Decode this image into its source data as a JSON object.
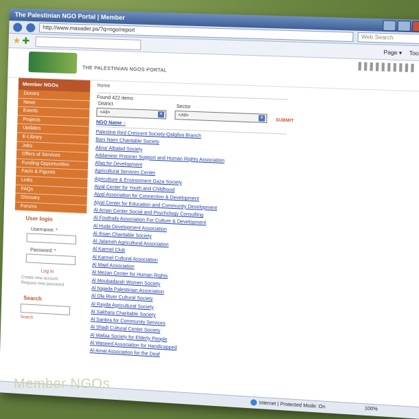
{
  "caption": "Member NGOs",
  "window": {
    "title": "The Palestinian NGO Portal | Member",
    "url": "http://www.masader.ps/?q=ngo/report",
    "search_placeholder": "Web Search"
  },
  "toolbar": {
    "page_label": "Page ▾",
    "tools_label": "Tools ▾"
  },
  "site": {
    "title": "THE PALESTINIAN NGOS PORTAL"
  },
  "sidebar": {
    "header": "Member NGOs",
    "items": [
      "Donors",
      "News",
      "Events",
      "Projects",
      "Updates",
      "E-Library",
      "Jobs",
      "Offers of Services",
      "Funding Opportunities",
      "Facts & Figures",
      "Links",
      "FAQs",
      "Glossary",
      "Forums"
    ]
  },
  "login": {
    "title": "User login",
    "username_label": "Username: *",
    "password_label": "Password: *",
    "button": "Log in",
    "links": [
      "Create new account",
      "Request new password"
    ]
  },
  "search": {
    "title": "Search",
    "link": "Search"
  },
  "main": {
    "breadcrumb": "Home",
    "found": "Found 422 items",
    "district_label": "District",
    "sector_label": "Sector",
    "district_value": "<All>",
    "sector_value": "<All>",
    "submit": "SUBMIT",
    "list_header": "NGO Name ↑",
    "ngos": [
      "Palestine Red Crescent Society-Qalqilya Branch",
      "Bani Naim Charitable Society",
      "Abna' Albalad Society",
      "Addameer Prisoner Support and Human Rights Association",
      "Afaq for Development",
      "Agricultural Services Center",
      "Agriculture & Environment Gaza Society",
      "Ajyal Center for Youth and Childhood",
      "Ajyal Association for Connection & Development",
      "Ajyal Center for Education and Community Development",
      "Al Aman Center Social and Psychology Consulting",
      "Al Fouthaily Association For Culture & Development",
      "Al Huda Development Association",
      "Al Ihsan Charitable Society",
      "Al Jalameh Agricultural Association",
      "Al Karmel Club",
      "Al Karmel Cultural Association",
      "Al Majd Association",
      "Al Mezan Center for Human Rights",
      "Al Moubadarah Women Society",
      "Al Najada Palestinian Association",
      "Al Ola River Cultural Society",
      "Al Rayda Agricultural Society",
      "Al Sakhara Charitable Society",
      "Al Sanbra for Community Services",
      "Al Shadi Cultural Center Society",
      "Al Wafaa Society for Elderly People",
      "Al Waseed Association for Handicapped",
      "Al-Amal Association for the Deaf"
    ]
  },
  "status": {
    "zone": "Internet | Protected Mode: On",
    "zoom": "100%"
  }
}
